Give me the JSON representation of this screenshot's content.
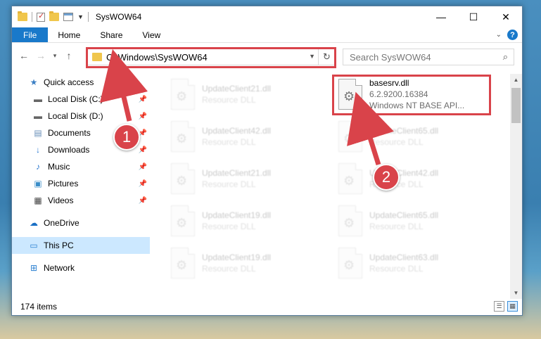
{
  "window": {
    "title": "SysWOW64",
    "controls": {
      "minimize": "—",
      "maximize": "☐",
      "close": "✕"
    }
  },
  "ribbon": {
    "tabs": [
      "File",
      "Home",
      "Share",
      "View"
    ]
  },
  "address": {
    "path": "C:\\Windows\\SysWOW64"
  },
  "search": {
    "placeholder": "Search SysWOW64"
  },
  "sidebar": {
    "items": [
      {
        "label": "Quick access",
        "icon": "star-icon"
      },
      {
        "label": "Local Disk (C:)",
        "icon": "drive-icon",
        "pinned": true
      },
      {
        "label": "Local Disk (D:)",
        "icon": "drive-icon",
        "pinned": true
      },
      {
        "label": "Documents",
        "icon": "documents-icon",
        "pinned": true
      },
      {
        "label": "Downloads",
        "icon": "download-icon",
        "pinned": true
      },
      {
        "label": "Music",
        "icon": "music-icon",
        "pinned": true
      },
      {
        "label": "Pictures",
        "icon": "pictures-icon",
        "pinned": true
      },
      {
        "label": "Videos",
        "icon": "videos-icon",
        "pinned": true
      },
      {
        "label": "OneDrive",
        "icon": "cloud-icon"
      },
      {
        "label": "This PC",
        "icon": "computer-icon",
        "selected": true
      },
      {
        "label": "Network",
        "icon": "network-icon"
      }
    ]
  },
  "files": [
    {
      "name": "UpdateClient21.dll",
      "type": "Resource DLL"
    },
    {
      "name": "basesrv.dll",
      "version": "6.2.9200.16384",
      "type": "Windows NT BASE API..."
    },
    {
      "name": "UpdateClient42.dll",
      "type": "Resource DLL"
    },
    {
      "name": "UpdateClient65.dll",
      "type": "Resource DLL"
    },
    {
      "name": "UpdateClient21.dll",
      "type": "Resource DLL"
    },
    {
      "name": "UpdateClient42.dll",
      "type": "Resource DLL"
    },
    {
      "name": "UpdateClient19.dll",
      "type": "Resource DLL"
    },
    {
      "name": "UpdateClient65.dll",
      "type": "Resource DLL"
    },
    {
      "name": "UpdateClient19.dll",
      "type": "Resource DLL"
    },
    {
      "name": "UpdateClient63.dll",
      "type": "Resource DLL"
    }
  ],
  "status": {
    "count": "174 items"
  },
  "annotations": {
    "step1": "1",
    "step2": "2",
    "color": "#d9434a"
  }
}
